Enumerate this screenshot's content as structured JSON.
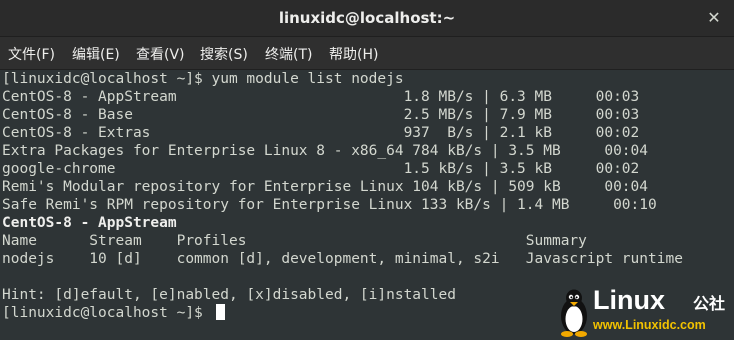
{
  "window": {
    "title": "linuxidc@localhost:~",
    "close_glyph": "✕"
  },
  "menu": {
    "items": [
      {
        "label": "文件(F)"
      },
      {
        "label": "编辑(E)"
      },
      {
        "label": "查看(V)"
      },
      {
        "label": "搜索(S)"
      },
      {
        "label": "终端(T)"
      },
      {
        "label": "帮助(H)"
      }
    ]
  },
  "terminal": {
    "lines": [
      "[linuxidc@localhost ~]$ yum module list nodejs",
      "CentOS-8 - AppStream                          1.8 MB/s | 6.3 MB     00:03",
      "CentOS-8 - Base                               2.5 MB/s | 7.9 MB     00:03",
      "CentOS-8 - Extras                             937  B/s | 2.1 kB     00:02",
      "Extra Packages for Enterprise Linux 8 - x86_64 784 kB/s | 3.5 MB     00:04",
      "google-chrome                                 1.5 kB/s | 3.5 kB     00:02",
      "Remi's Modular repository for Enterprise Linux 104 kB/s | 509 kB     00:04",
      "Safe Remi's RPM repository for Enterprise Linux 133 kB/s | 1.4 MB     00:10",
      "CentOS-8 - AppStream",
      "Name      Stream    Profiles                                Summary",
      "nodejs    10 [d]    common [d], development, minimal, s2i   Javascript runtime",
      "",
      "Hint: [d]efault, [e]nabled, [x]disabled, [i]nstalled",
      "[linuxidc@localhost ~]$ "
    ]
  },
  "watermark": {
    "brand": "Linux",
    "brand_cn": "公社",
    "url": "www.Linuxidc.com",
    "icon": "penguin-icon"
  }
}
